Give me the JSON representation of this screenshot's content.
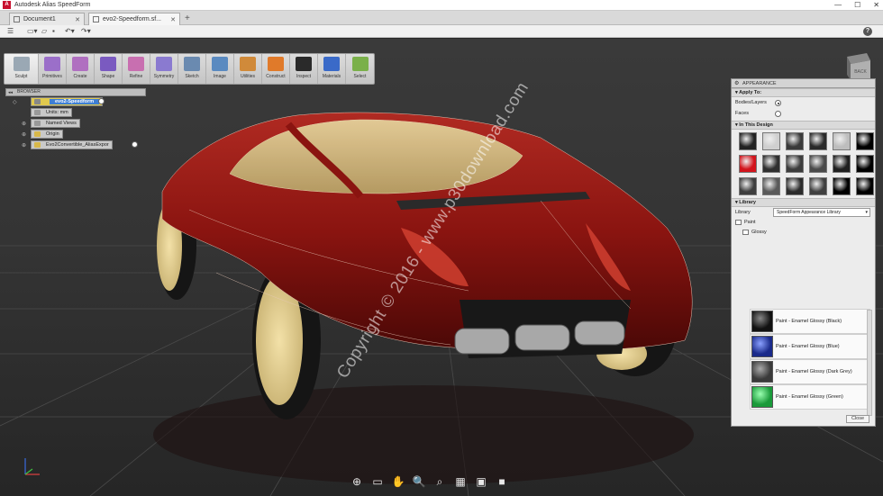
{
  "window": {
    "title": "Autodesk Alias SpeedForm",
    "app_icon": "A",
    "controls": {
      "minimize": "—",
      "maximize": "☐",
      "close": "✕"
    }
  },
  "tabs": [
    {
      "label": "Document1",
      "close": "✕"
    },
    {
      "label": "evo2-Speedform.sf...",
      "close": "✕"
    }
  ],
  "tab_add": "+",
  "help": "?",
  "ribbon": [
    {
      "label": "Sculpt",
      "icon": "sculpt-icon",
      "color": "#9aa8b4"
    },
    {
      "label": "Primitives",
      "icon": "primitives-icon",
      "color": "#9b6fc9"
    },
    {
      "label": "Create",
      "icon": "create-icon",
      "color": "#b06fc0"
    },
    {
      "label": "Shape",
      "icon": "shape-icon",
      "color": "#7a5ac0"
    },
    {
      "label": "Refine",
      "icon": "refine-icon",
      "color": "#c86fb0"
    },
    {
      "label": "Symmetry",
      "icon": "symmetry-icon",
      "color": "#8a7ad0"
    },
    {
      "label": "Sketch",
      "icon": "sketch-icon",
      "color": "#6a8ab0"
    },
    {
      "label": "Image",
      "icon": "image-icon",
      "color": "#5a8ac0"
    },
    {
      "label": "Utilities",
      "icon": "utilities-icon",
      "color": "#d08a3a"
    },
    {
      "label": "Construct",
      "icon": "construct-icon",
      "color": "#e07a2a"
    },
    {
      "label": "Inspect",
      "icon": "inspect-icon",
      "color": "#2a2a2a"
    },
    {
      "label": "Materials",
      "icon": "materials-icon",
      "color": "#3a6ac8"
    },
    {
      "label": "Select",
      "icon": "select-icon",
      "color": "#7ab04a"
    }
  ],
  "browser": {
    "title": "BROWSER",
    "root": "evo2-Speedform",
    "items": [
      {
        "label": "Units: mm"
      },
      {
        "label": "Named Views"
      },
      {
        "label": "Origin"
      },
      {
        "label": "Evo2Convertible_AliasExpor"
      }
    ]
  },
  "viewcube": {
    "face": "BACK"
  },
  "appearance": {
    "title": "APPEARANCE",
    "apply_to": {
      "heading": "Apply To:",
      "options": [
        {
          "label": "Bodies/Layers",
          "selected": true
        },
        {
          "label": "Faces",
          "selected": false
        }
      ]
    },
    "in_this_design": {
      "heading": "In This Design",
      "swatches": [
        "#222222",
        "#cfcfcf",
        "#3a3a3a",
        "#2a2a2a",
        "#bdbdbd",
        "#000000",
        "#d2141c",
        "#2f2f2f",
        "#3c3c3c",
        "#4a4a4a",
        "#1f1f1f",
        "#000000",
        "#3e3e3e",
        "#5a5a5a",
        "#2c2c2c",
        "#404040",
        "#000000",
        "#000000"
      ]
    },
    "library": {
      "heading": "Library",
      "label": "Library",
      "selected": "SpeedForm Appearance Library",
      "caret": "▾",
      "folder": "Paint",
      "subfolder": "Glossy",
      "materials": [
        {
          "label": "Paint - Enamel Glossy (Black)",
          "color": "#111111"
        },
        {
          "label": "Paint - Enamel Glossy (Blue)",
          "color": "#1a2a8a"
        },
        {
          "label": "Paint - Enamel Glossy (Dark Grey)",
          "color": "#3a3a3a"
        },
        {
          "label": "Paint - Enamel Glossy (Green)",
          "color": "#1a9a3a"
        }
      ]
    },
    "close": "Close"
  },
  "watermark": "Copyright © 2016 - www.p30download.com",
  "navbar": [
    {
      "icon": "orbit-icon",
      "glyph": "⊕"
    },
    {
      "icon": "look-at-icon",
      "glyph": "▭"
    },
    {
      "icon": "pan-icon",
      "glyph": "✋"
    },
    {
      "icon": "zoom-icon",
      "glyph": "🔍"
    },
    {
      "icon": "zoom-window-icon",
      "glyph": "⌕"
    },
    {
      "icon": "grid-icon",
      "glyph": "▦"
    },
    {
      "icon": "display-icon",
      "glyph": "▣"
    },
    {
      "icon": "visual-style-icon",
      "glyph": "■"
    }
  ]
}
